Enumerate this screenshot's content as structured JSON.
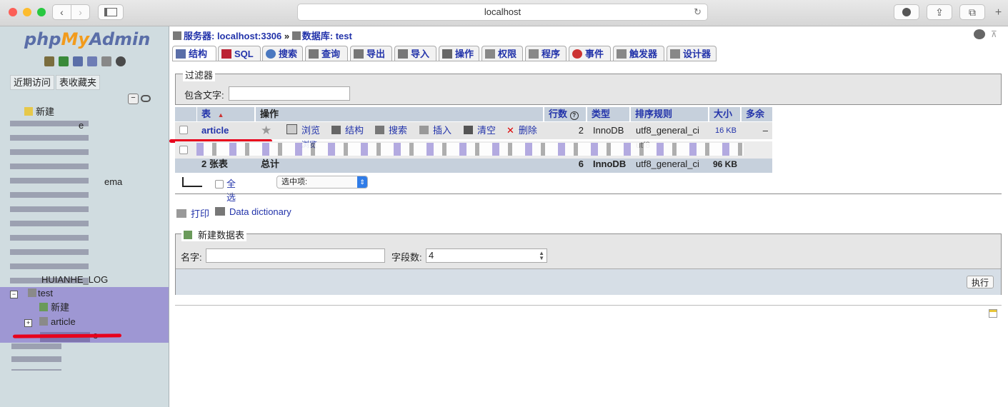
{
  "browser": {
    "url": "localhost"
  },
  "sidebar": {
    "logo": {
      "php": "php",
      "my": "My",
      "admin": "Admin"
    },
    "buttons": [
      "近期访问",
      "表收藏夹"
    ],
    "tree": [
      {
        "label": "新建"
      },
      {
        "label": "e"
      },
      {
        "label": "ema"
      },
      {
        "label": "HUIANHE_LOG"
      },
      {
        "label": "test"
      },
      {
        "label": "新建"
      },
      {
        "label": "article"
      },
      {
        "label": "e"
      }
    ]
  },
  "breadcrumb": {
    "server": "服务器: localhost:3306",
    "sep": "»",
    "database": "数据库: test"
  },
  "tabs": [
    "结构",
    "SQL",
    "搜索",
    "查询",
    "导出",
    "导入",
    "操作",
    "权限",
    "程序",
    "事件",
    "触发器",
    "设计器"
  ],
  "filter": {
    "legend": "过滤器",
    "label": "包含文字:",
    "value": ""
  },
  "table": {
    "headers": [
      "表",
      "操作",
      "行数",
      "类型",
      "排序规则",
      "大小",
      "多余"
    ],
    "rows": [
      {
        "name": "article",
        "actions": [
          "浏览",
          "结构",
          "搜索",
          "插入",
          "清空",
          "删除"
        ],
        "rows": "2",
        "type": "InnoDB",
        "collation": "utf8_general_ci",
        "size": "16 KB",
        "overhead": "–"
      }
    ],
    "row2_partial": {
      "browse": "浏览",
      "collation": "utf8"
    },
    "summary": {
      "name": "2 张表",
      "label": "总计",
      "rows": "6",
      "type": "InnoDB",
      "collation": "utf8_general_ci",
      "size": "96 KB"
    },
    "check_all": "全选",
    "with_selected": "选中项:"
  },
  "links": {
    "print": "打印",
    "data_dictionary": "Data dictionary"
  },
  "new_table": {
    "legend": "新建数据表",
    "name_label": "名字:",
    "name_value": "",
    "fields_label": "字段数:",
    "fields_value": "4",
    "go": "执行"
  },
  "colors": {
    "link": "#2233aa",
    "header": "#c6d0dc",
    "highlight": "#9e97d3",
    "underline": "#e8001c"
  }
}
